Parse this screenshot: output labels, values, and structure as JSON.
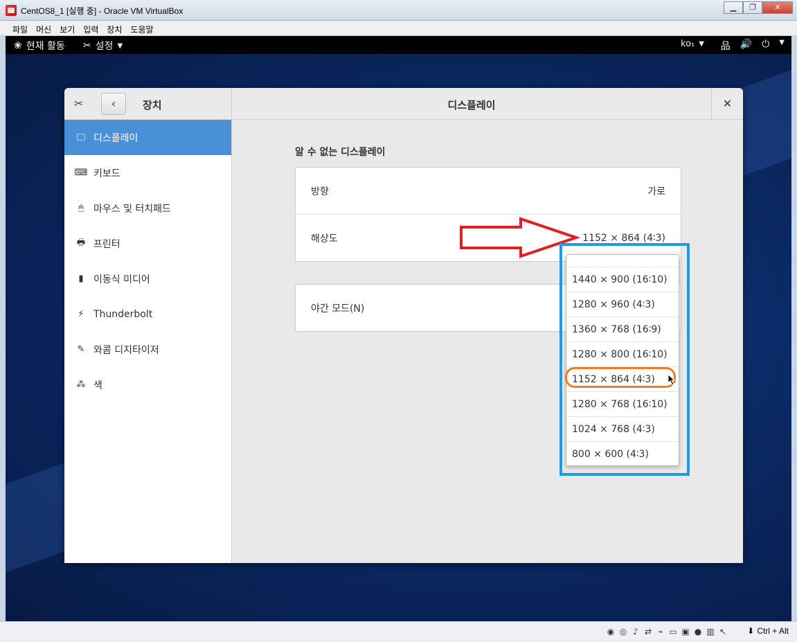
{
  "host": {
    "title": "CentOS8_1 [실행 중] - Oracle VM VirtualBox",
    "window_buttons": [
      "▁",
      "❐",
      "✕"
    ],
    "menu": [
      "파일",
      "머신",
      "보기",
      "입력",
      "장치",
      "도움말"
    ],
    "host_key": "Ctrl + Alt",
    "status_icons": [
      "hdd-icon",
      "optical-icon",
      "audio-icon",
      "network-icon",
      "usb-icon",
      "shared-folder-icon",
      "display-icon",
      "recording-icon",
      "cpu-icon",
      "mouse-integration-icon",
      "hostkey-icon"
    ]
  },
  "topbar": {
    "activities": "현재 활동",
    "settings": "설정",
    "input_method": "ko₁",
    "icons": [
      "network-icon",
      "volume-icon",
      "power-icon"
    ]
  },
  "settings_window": {
    "section": "장치",
    "title": "디스플레이",
    "sidebar": [
      {
        "label": "디스플레이",
        "icon": "🖵",
        "icon_name": "display-icon",
        "active": true
      },
      {
        "label": "키보드",
        "icon": "⌨",
        "icon_name": "keyboard-icon",
        "active": false
      },
      {
        "label": "마우스 및 터치패드",
        "icon": "🖱",
        "icon_name": "mouse-icon",
        "active": false
      },
      {
        "label": "프린터",
        "icon": "🖶",
        "icon_name": "printer-icon",
        "active": false
      },
      {
        "label": "이동식 미디어",
        "icon": "▮",
        "icon_name": "removable-media-icon",
        "active": false
      },
      {
        "label": "Thunderbolt",
        "icon": "⚡",
        "icon_name": "thunderbolt-icon",
        "active": false
      },
      {
        "label": "와콤 디지타이저",
        "icon": "✎",
        "icon_name": "wacom-icon",
        "active": false
      },
      {
        "label": "색",
        "icon": "⁂",
        "icon_name": "color-icon",
        "active": false
      }
    ],
    "monitor_name": "알 수 없는 디스플레이",
    "rows": {
      "orientation_label": "방향",
      "orientation_value": "가로",
      "resolution_label": "해상도",
      "resolution_value": "1152 × 864 (4∶3)",
      "night_mode_label": "야간 모드(N)"
    },
    "resolution_options": [
      "1440 × 900 (16∶10)",
      "1280 × 960 (4∶3)",
      "1360 × 768 (16∶9)",
      "1280 × 800 (16∶10)",
      "1152 × 864 (4∶3)",
      "1280 × 768 (16∶10)",
      "1024 × 768 (4∶3)",
      "800 × 600 (4∶3)"
    ],
    "selected_option": "1152 × 864 (4∶3)"
  },
  "colors": {
    "accent": "#4a90d9",
    "annotation_blue": "#1e9be6",
    "annotation_orange": "#f07d1e",
    "annotation_red": "#e02020"
  }
}
